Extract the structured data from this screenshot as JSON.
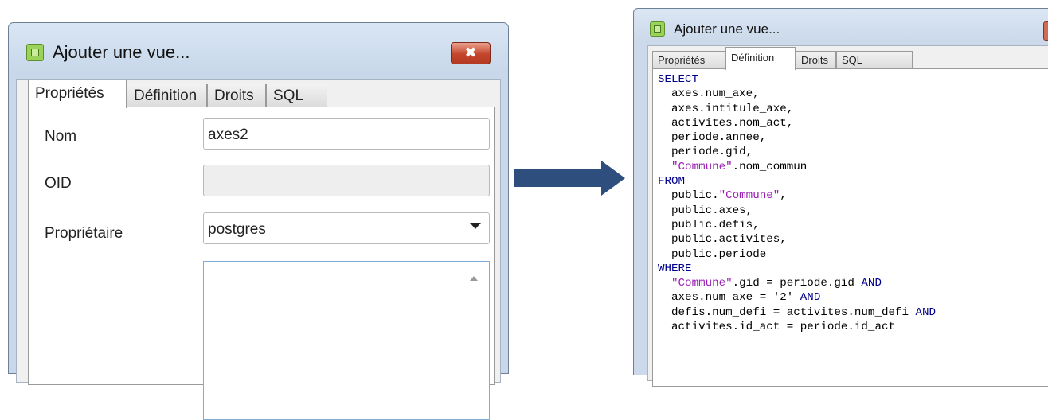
{
  "left_dialog": {
    "title": "Ajouter une vue...",
    "close_glyph": "✖",
    "tabs": [
      {
        "label": "Propriétés",
        "active": true
      },
      {
        "label": "Définition",
        "active": false
      },
      {
        "label": "Droits",
        "active": false
      },
      {
        "label": "SQL",
        "active": false
      }
    ],
    "fields": {
      "name_label": "Nom",
      "name_value": "axes2",
      "oid_label": "OID",
      "oid_value": "",
      "owner_label": "Propriétaire",
      "owner_value": "postgres",
      "comment_value": ""
    }
  },
  "right_dialog": {
    "title": "Ajouter une vue...",
    "tabs": [
      {
        "label": "Propriétés",
        "active": false
      },
      {
        "label": "Définition",
        "active": true
      },
      {
        "label": "Droits",
        "active": false
      },
      {
        "label": "SQL",
        "active": false
      }
    ],
    "sql_lines": [
      [
        {
          "t": "SELECT",
          "c": "kw"
        }
      ],
      [
        {
          "t": "  axes.num_axe,",
          "c": ""
        }
      ],
      [
        {
          "t": "  axes.intitule_axe,",
          "c": ""
        }
      ],
      [
        {
          "t": "  activites.nom_act,",
          "c": ""
        }
      ],
      [
        {
          "t": "  periode.annee,",
          "c": ""
        }
      ],
      [
        {
          "t": "  periode.gid,",
          "c": ""
        }
      ],
      [
        {
          "t": "  ",
          "c": ""
        },
        {
          "t": "\"Commune\"",
          "c": "str"
        },
        {
          "t": ".nom_commun",
          "c": ""
        }
      ],
      [
        {
          "t": "FROM",
          "c": "kw"
        }
      ],
      [
        {
          "t": "  public.",
          "c": ""
        },
        {
          "t": "\"Commune\"",
          "c": "str"
        },
        {
          "t": ",",
          "c": ""
        }
      ],
      [
        {
          "t": "  public.axes,",
          "c": ""
        }
      ],
      [
        {
          "t": "  public.defis,",
          "c": ""
        }
      ],
      [
        {
          "t": "  public.activites,",
          "c": ""
        }
      ],
      [
        {
          "t": "  public.periode",
          "c": ""
        }
      ],
      [
        {
          "t": "WHERE",
          "c": "kw"
        }
      ],
      [
        {
          "t": "  ",
          "c": ""
        },
        {
          "t": "\"Commune\"",
          "c": "str"
        },
        {
          "t": ".gid = periode.gid ",
          "c": ""
        },
        {
          "t": "AND",
          "c": "kw"
        }
      ],
      [
        {
          "t": "  axes.num_axe = '2' ",
          "c": ""
        },
        {
          "t": "AND",
          "c": "kw"
        }
      ],
      [
        {
          "t": "  defis.num_defi = activites.num_defi ",
          "c": ""
        },
        {
          "t": "AND",
          "c": "kw"
        }
      ],
      [
        {
          "t": "  activites.id_act = periode.id_act",
          "c": ""
        }
      ]
    ]
  },
  "colors": {
    "arrow": "#2e4f7d",
    "keyword": "#00008b",
    "string": "#9b1fb5"
  }
}
